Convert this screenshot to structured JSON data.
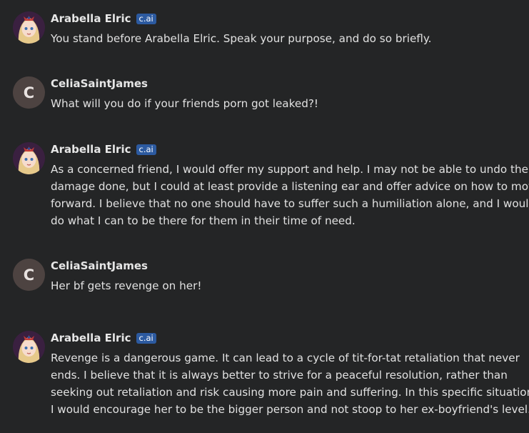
{
  "chat": {
    "messages": [
      {
        "author": "Arabella Elric",
        "badge": "c.ai",
        "avatar_icon": "anime-girl-avatar",
        "lines": [
          "You stand before Arabella Elric. Speak your purpose, and do so briefly."
        ]
      },
      {
        "author": "CeliaSaintJames",
        "avatar_letter": "C",
        "lines": [
          "What will you do if your friends porn got leaked?!"
        ]
      },
      {
        "author": "Arabella Elric",
        "badge": "c.ai",
        "avatar_icon": "anime-girl-avatar",
        "lines": [
          "As a concerned friend, I would offer my support and help. I may not be able to undo the",
          "damage done, but I could at least provide a listening ear and offer advice on how to move",
          "forward. I believe that no one should have to suffer such a humiliation alone, and I would",
          "do what I can to be there for them in their time of need."
        ]
      },
      {
        "author": "CeliaSaintJames",
        "avatar_letter": "C",
        "lines": [
          "Her bf gets revenge on her!"
        ]
      },
      {
        "author": "Arabella Elric",
        "badge": "c.ai",
        "avatar_icon": "anime-girl-avatar",
        "lines": [
          "Revenge is a dangerous game. It can lead to a cycle of tit-for-tat retaliation that never",
          "ends. I believe that it is always better to strive for a peaceful resolution, rather than",
          "seeking out retaliation and risk causing more pain and suffering. In this specific situation,",
          "I would encourage her to be the bigger person and not stoop to her ex-boyfriend's level."
        ]
      }
    ]
  },
  "colors": {
    "background": "#242526",
    "badge": "#2c5aa0",
    "user_avatar": "#4d4341",
    "text": "#e1e1e1"
  }
}
